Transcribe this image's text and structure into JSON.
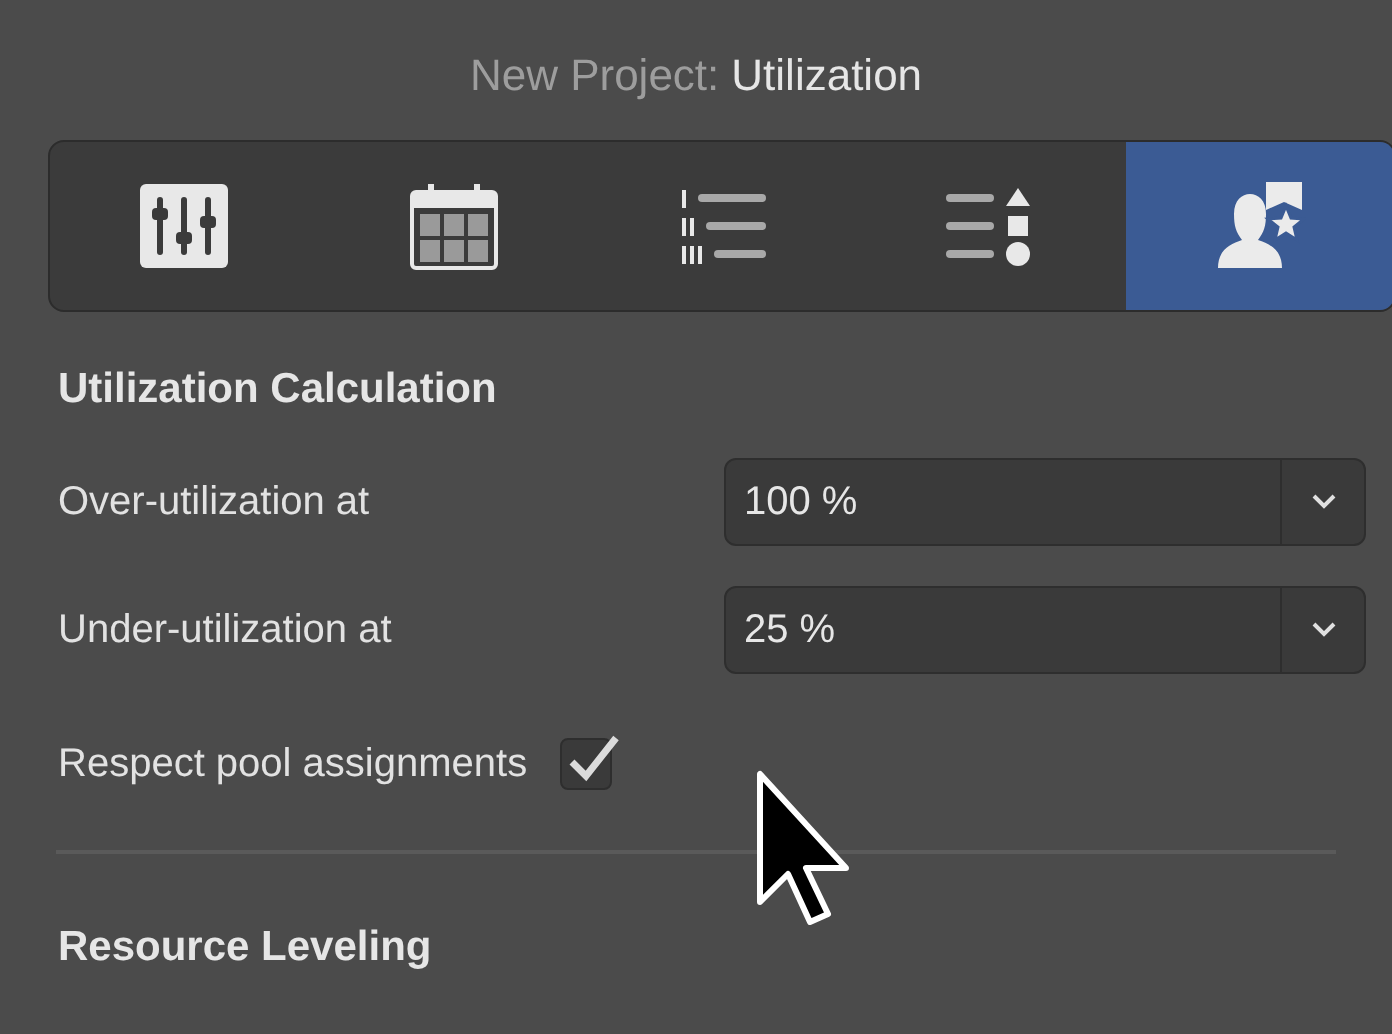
{
  "window": {
    "title_prefix": "New Project:",
    "title_name": "Utilization"
  },
  "tabs": [
    {
      "kind": "sliders",
      "selected": false
    },
    {
      "kind": "calendar",
      "selected": false
    },
    {
      "kind": "numbered-list",
      "selected": false
    },
    {
      "kind": "shapes-list",
      "selected": false
    },
    {
      "kind": "resource",
      "selected": true
    }
  ],
  "sections": [
    {
      "heading": "Utilization Calculation",
      "rows": [
        {
          "kind": "select",
          "label": "Over-utilization at",
          "value": "100 %"
        },
        {
          "kind": "select",
          "label": "Under-utilization at",
          "value": "25 %"
        },
        {
          "kind": "checkbox",
          "label": "Respect pool assignments",
          "checked": true
        }
      ]
    },
    {
      "heading": "Resource Leveling"
    }
  ]
}
